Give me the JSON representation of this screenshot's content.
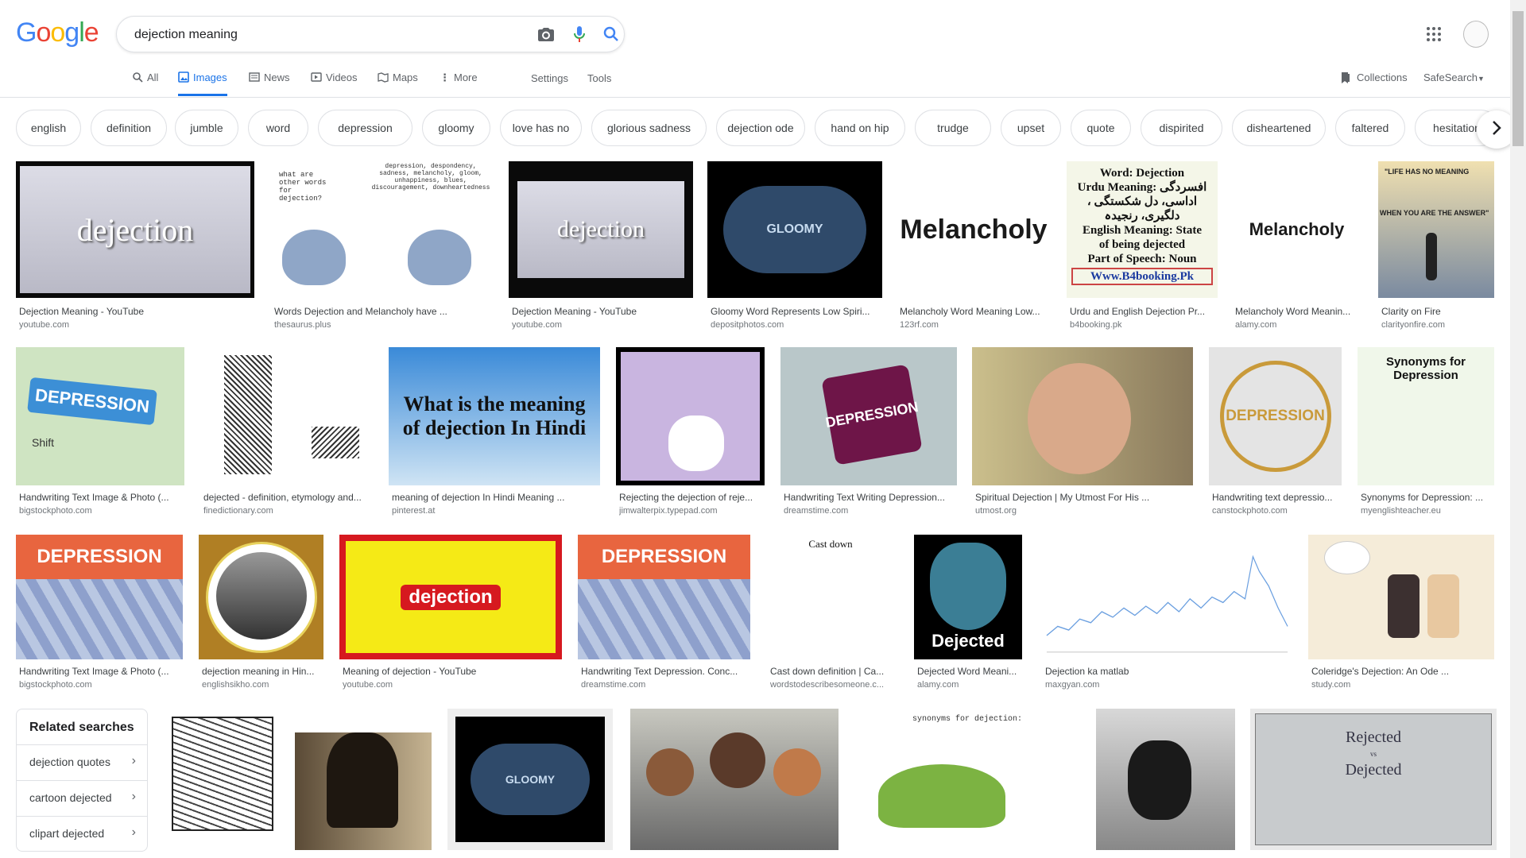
{
  "search": {
    "query": "dejection meaning"
  },
  "logo": {
    "letters": [
      "G",
      "o",
      "o",
      "g",
      "l",
      "e"
    ],
    "colors": [
      "#4285F4",
      "#EA4335",
      "#FBBC05",
      "#4285F4",
      "#34A853",
      "#EA4335"
    ]
  },
  "tabs": [
    {
      "label": "All"
    },
    {
      "label": "Images"
    },
    {
      "label": "News"
    },
    {
      "label": "Videos"
    },
    {
      "label": "Maps"
    },
    {
      "label": "More"
    }
  ],
  "tools": {
    "settings": "Settings",
    "tools": "Tools",
    "collections": "Collections",
    "safesearch": "SafeSearch"
  },
  "chips": [
    "english",
    "definition",
    "jumble",
    "word",
    "depression",
    "gloomy",
    "love has no",
    "glorious sadness",
    "dejection ode",
    "hand on hip",
    "trudge",
    "upset",
    "quote",
    "dispirited",
    "disheartened",
    "faltered",
    "hesitation"
  ],
  "results": [
    {
      "title": "Dejection Meaning - YouTube",
      "source": "youtube.com"
    },
    {
      "title": "Words Dejection and Melancholy have ...",
      "source": "thesaurus.plus"
    },
    {
      "title": "Dejection Meaning - YouTube",
      "source": "youtube.com"
    },
    {
      "title": "Gloomy Word Represents Low Spiri...",
      "source": "depositphotos.com"
    },
    {
      "title": "Melancholy Word Meaning Low...",
      "source": "123rf.com"
    },
    {
      "title": "Urdu and English Dejection Pr...",
      "source": "b4booking.pk"
    },
    {
      "title": "Melancholy Word Meanin...",
      "source": "alamy.com"
    },
    {
      "title": "Clarity on Fire",
      "source": "clarityonfire.com"
    },
    {
      "title": "Handwriting Text Image & Photo (...",
      "source": "bigstockphoto.com"
    },
    {
      "title": "dejected - definition, etymology and...",
      "source": "finedictionary.com"
    },
    {
      "title": "meaning of dejection In Hindi Meaning ...",
      "source": "pinterest.at"
    },
    {
      "title": "Rejecting the dejection of reje...",
      "source": "jimwalterpix.typepad.com"
    },
    {
      "title": "Handwriting Text Writing Depression...",
      "source": "dreamstime.com"
    },
    {
      "title": "Spiritual Dejection | My Utmost For His ...",
      "source": "utmost.org"
    },
    {
      "title": "Handwriting text depressio...",
      "source": "canstockphoto.com"
    },
    {
      "title": "Synonyms for Depression: ...",
      "source": "myenglishteacher.eu"
    },
    {
      "title": "Handwriting Text Image & Photo (...",
      "source": "bigstockphoto.com"
    },
    {
      "title": "dejection meaning in Hin...",
      "source": "englishsikho.com"
    },
    {
      "title": "Meaning of dejection - YouTube",
      "source": "youtube.com"
    },
    {
      "title": "Handwriting Text Depression. Conc...",
      "source": "dreamstime.com"
    },
    {
      "title": "Cast down definition | Ca...",
      "source": "wordstodescribesomeone.c..."
    },
    {
      "title": "Dejected Word Meani...",
      "source": "alamy.com"
    },
    {
      "title": "Dejection ka matlab",
      "source": "maxgyan.com"
    },
    {
      "title": "Coleridge's Dejection: An Ode ...",
      "source": "study.com"
    }
  ],
  "thumb_text": {
    "dejection": "dejection",
    "pigeons": "what are other words for dejection?",
    "pigeons_list": "depression, despondency, sadness, melancholy, gloom, unhappiness, blues, discouragement, downheartedness",
    "gloomy": "GLOOMY",
    "melancholy": "Melancholy",
    "urdu1": "Word: Dejection",
    "urdu2": "Urdu Meaning: افسردگی",
    "urdu3": "، اداسی، دل شکستگی",
    "urdu4": "دلگیری، رنجیدہ",
    "urdu5": "English Meaning: State",
    "urdu6": "of being dejected",
    "urdu7": "Part of Speech: Noun",
    "urdu8": "Www.B4booking.Pk",
    "clarity": "\"LIFE HAS NO MEANING",
    "clarity2": "WHEN YOU ARE THE ANSWER\"",
    "depression": "DEPRESSION",
    "shift": "Shift",
    "hindi": "What is the meaning of dejection In Hindi",
    "synonyms": "Synonyms for Depression",
    "castdown": "Cast down",
    "dejected": "Dejected",
    "dejection_red": "dejection",
    "rejected": "Rejected",
    "vs": "vs",
    "dejected2": "Dejected",
    "synonyms_dej": "synonyms for dejection:"
  },
  "related": {
    "heading": "Related searches",
    "items": [
      "dejection quotes",
      "cartoon dejected",
      "clipart dejected"
    ]
  }
}
